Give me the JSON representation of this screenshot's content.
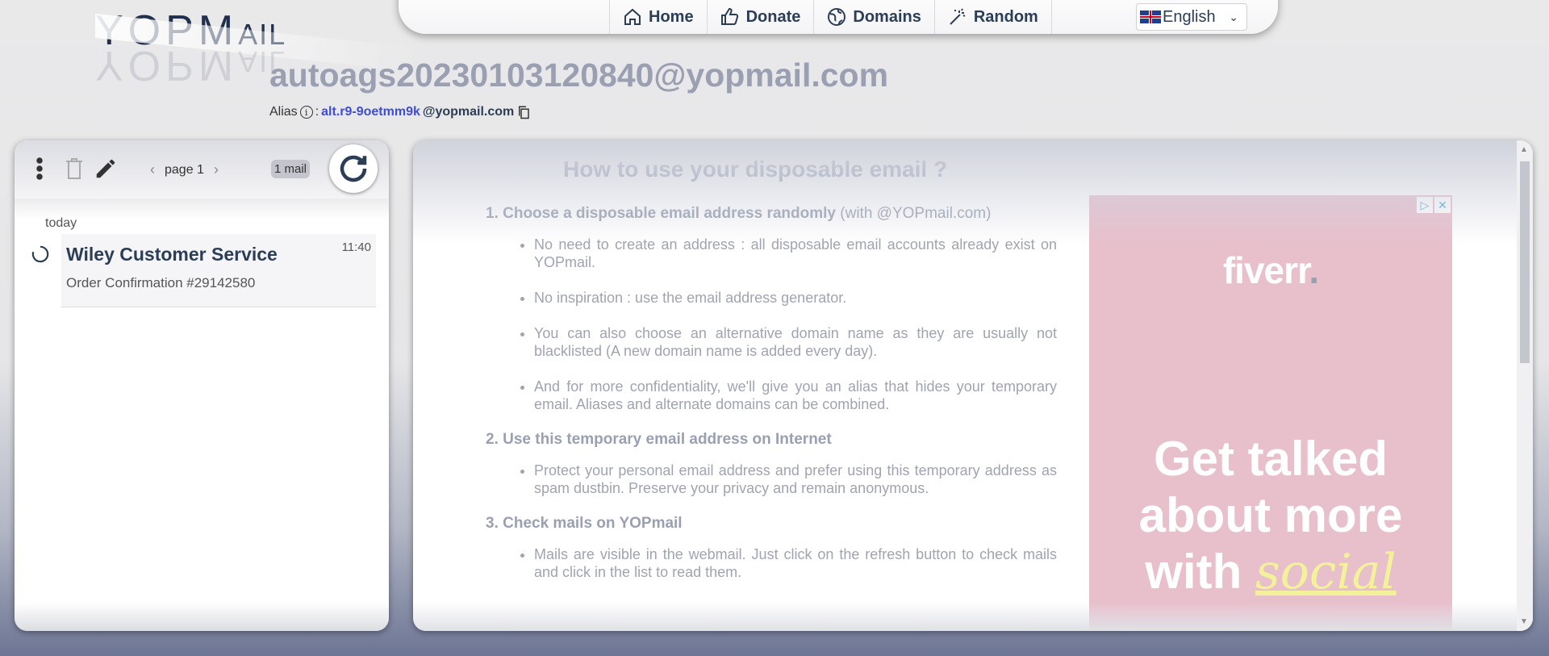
{
  "logo": {
    "main": "YOPM",
    "small": "AIL"
  },
  "nav": {
    "items": [
      {
        "label": "Home",
        "icon": "home-icon"
      },
      {
        "label": "Donate",
        "icon": "thumbs-up-icon"
      },
      {
        "label": "Domains",
        "icon": "globe-icon"
      },
      {
        "label": "Random",
        "icon": "magic-wand-icon"
      }
    ],
    "language": "English"
  },
  "email": {
    "address": "autoags20230103120840@yopmail.com",
    "alias_label": "Alias",
    "alias_sep": ":",
    "alias_value": "alt.r9-9oetmm9k",
    "alias_domain": "@yopmail.com"
  },
  "inbox": {
    "page_label": "page 1",
    "mail_count": "1 mail",
    "day": "today",
    "mails": [
      {
        "from": "Wiley Customer Service",
        "subject": "Order Confirmation #29142580",
        "time": "11:40"
      }
    ]
  },
  "howto": {
    "title": "How to use your disposable email ?",
    "step1": "1. Choose a disposable email address randomly",
    "step1_light": "(with @YOPmail.com)",
    "step1_items": [
      "No need to create an address : all disposable email accounts already exist on YOPmail.",
      "No inspiration : use the email address generator.",
      "You can also choose an alternative domain name as they are usually not blacklisted (A new domain name is added every day).",
      "And for more confidentiality, we'll give you an alias that hides your temporary email. Aliases and alternate domains can be combined."
    ],
    "step2": "2. Use this temporary email address on Internet",
    "step2_items": [
      "Protect your personal email address and prefer using this temporary address as spam dustbin. Preserve your privacy and remain anonymous."
    ],
    "step3": "3. Check mails on YOPmail",
    "step3_items": [
      "Mails are visible in the webmail. Just click on the refresh button to check mails and click in the list to read them."
    ]
  },
  "ad": {
    "brand": "fiverr",
    "brand_dot": ".",
    "line1": "Get talked",
    "line2": "about more",
    "line3_a": "with ",
    "line3_b": "social"
  }
}
